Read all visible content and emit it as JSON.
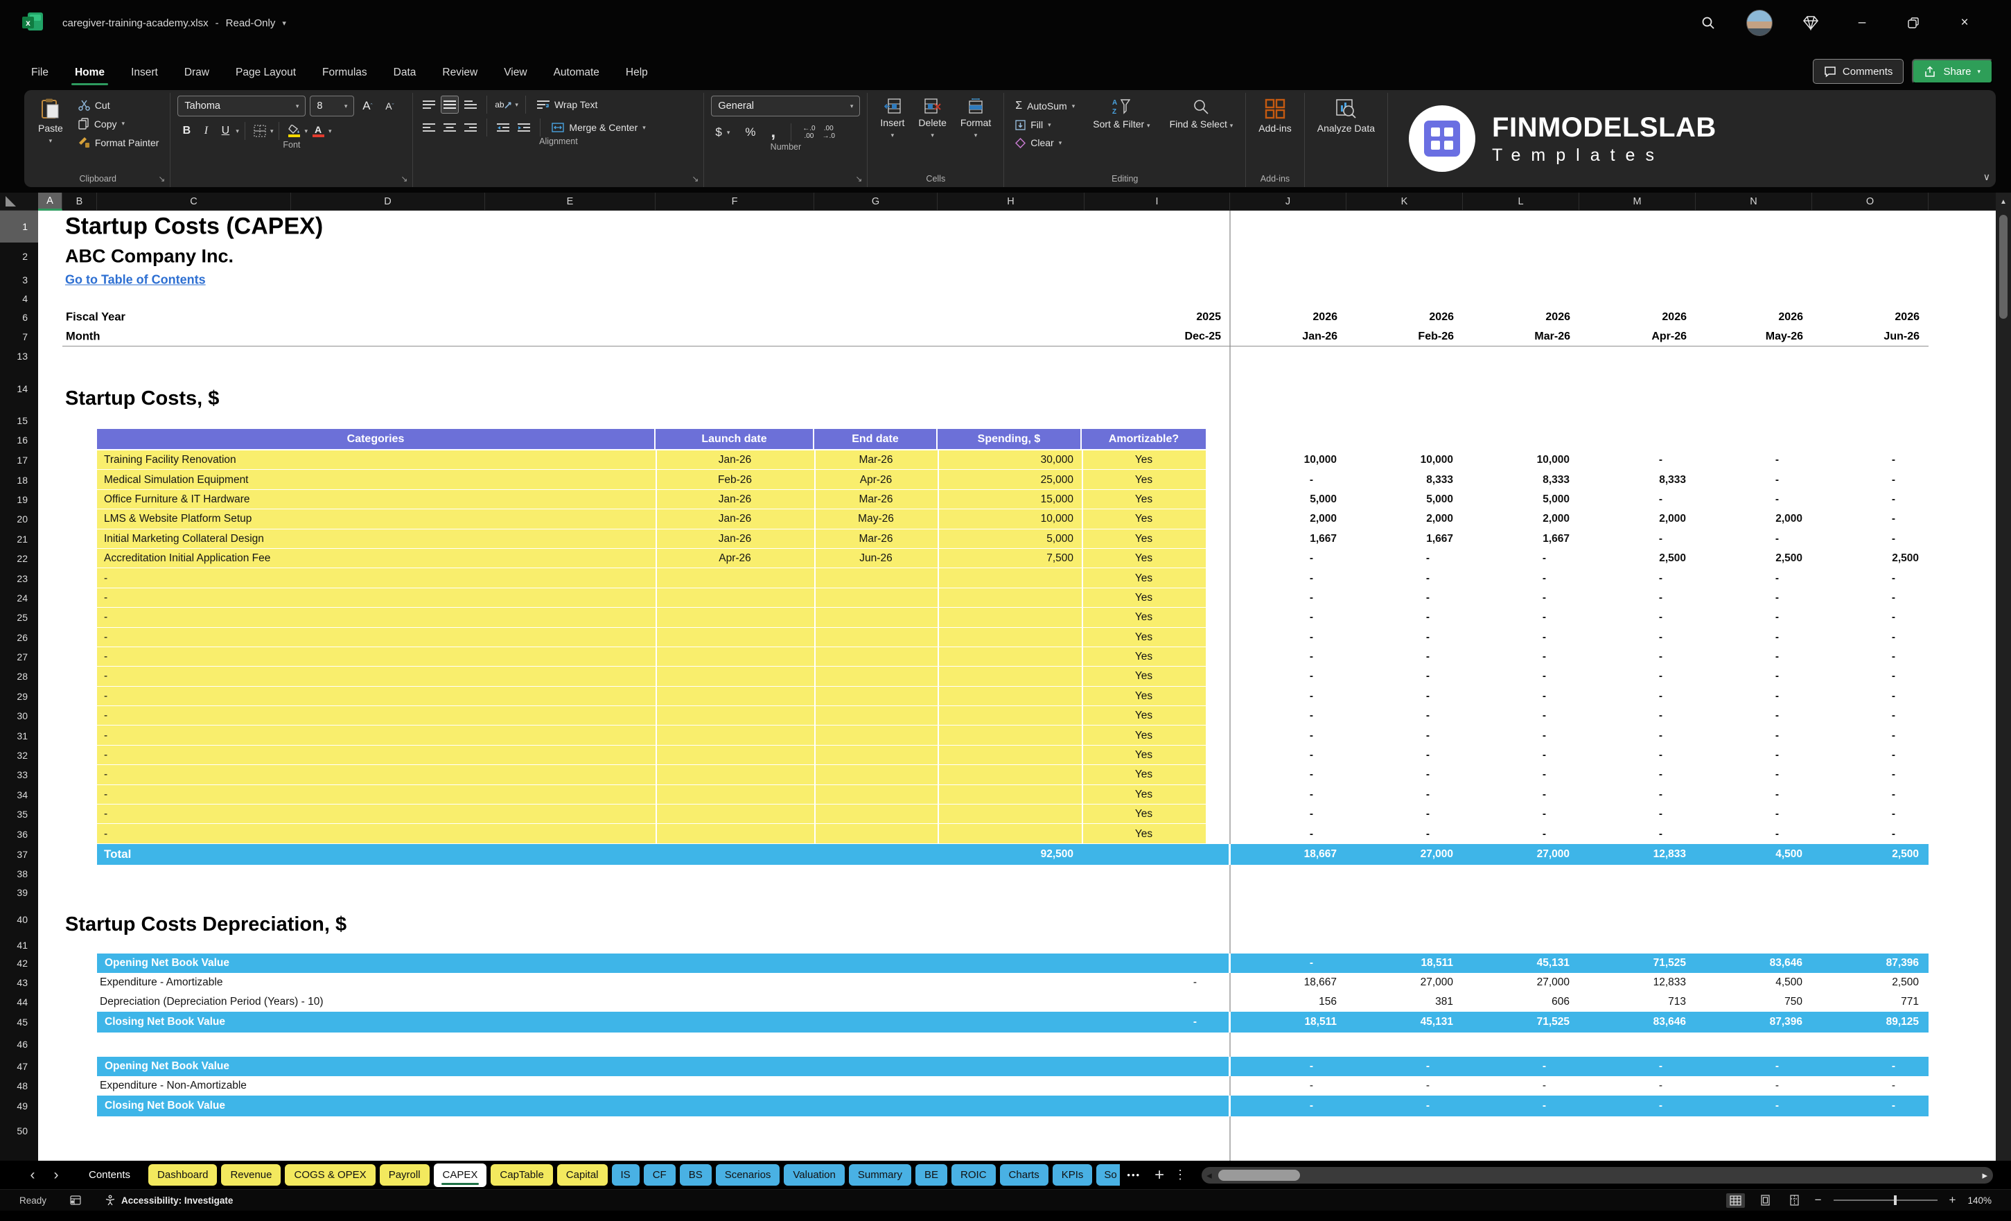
{
  "window": {
    "filename": "caregiver-training-academy.xlsx",
    "dash": "-",
    "mode": "Read-Only"
  },
  "menu": {
    "tabs": [
      "File",
      "Home",
      "Insert",
      "Draw",
      "Page Layout",
      "Formulas",
      "Data",
      "Review",
      "View",
      "Automate",
      "Help"
    ],
    "active_tab": "Home",
    "comments_label": "Comments",
    "share_label": "Share"
  },
  "ribbon": {
    "clipboard": {
      "label": "Clipboard",
      "paste": "Paste",
      "cut": "Cut",
      "copy": "Copy",
      "format_painter": "Format Painter"
    },
    "font": {
      "label": "Font",
      "family": "Tahoma",
      "size": "8",
      "bold": "B",
      "italic": "I",
      "underline": "U"
    },
    "alignment": {
      "label": "Alignment",
      "wrap_text": "Wrap Text",
      "merge_center": "Merge & Center"
    },
    "number": {
      "label": "Number",
      "format": "General",
      "currency": "$",
      "percent": "%",
      "comma": ",",
      "increase_decimal": "←.0\n.00",
      "decrease_decimal": ".00\n→.0"
    },
    "cells": {
      "label": "Cells",
      "insert": "Insert",
      "delete": "Delete",
      "format": "Format"
    },
    "editing": {
      "label": "Editing",
      "sigma": "Σ",
      "autosum": "AutoSum",
      "fill": "Fill",
      "clear": "Clear",
      "sort_filter": "Sort & Filter",
      "find_select": "Find & Select"
    },
    "addins": {
      "label": "Add-ins",
      "button": "Add-ins",
      "analyze": "Analyze Data"
    }
  },
  "brand": {
    "name": "FINMODELSLAB",
    "sub": "Templates"
  },
  "grid": {
    "columns": [
      "A",
      "B",
      "C",
      "D",
      "E",
      "F",
      "G",
      "H",
      "I",
      "J",
      "K",
      "L",
      "M",
      "N",
      "O"
    ],
    "selected_column": "A",
    "rows": [
      1,
      2,
      3,
      4,
      6,
      7,
      13,
      14,
      15,
      16,
      17,
      18,
      19,
      20,
      21,
      22,
      23,
      24,
      25,
      26,
      27,
      28,
      29,
      30,
      31,
      32,
      33,
      34,
      35,
      36,
      37,
      38,
      39,
      40,
      41,
      42,
      43,
      44,
      45,
      46,
      47,
      48,
      49,
      50
    ],
    "selected_row": 1
  },
  "sheet": {
    "title": "Startup Costs (CAPEX)",
    "company": "ABC Company Inc.",
    "toc_link": "Go to Table of Contents",
    "fiscal_year_label": "Fiscal Year",
    "month_label": "Month",
    "fiscal_years": [
      "2025",
      "2026",
      "2026",
      "2026",
      "2026",
      "2026",
      "2026"
    ],
    "months": [
      "Dec-25",
      "Jan-26",
      "Feb-26",
      "Mar-26",
      "Apr-26",
      "May-26",
      "Jun-26"
    ],
    "section_costs": {
      "heading": "Startup Costs, $",
      "columns": [
        "Categories",
        "Launch date",
        "End date",
        "Spending, $",
        "Amortizable?"
      ],
      "rows": [
        {
          "category": "Training Facility Renovation",
          "launch": "Jan-26",
          "end": "Mar-26",
          "spending": "30,000",
          "amortizable": "Yes",
          "monthly": [
            "10,000",
            "10,000",
            "10,000",
            "-",
            "-",
            "-"
          ]
        },
        {
          "category": "Medical Simulation Equipment",
          "launch": "Feb-26",
          "end": "Apr-26",
          "spending": "25,000",
          "amortizable": "Yes",
          "monthly": [
            "-",
            "8,333",
            "8,333",
            "8,333",
            "-",
            "-"
          ]
        },
        {
          "category": "Office Furniture & IT Hardware",
          "launch": "Jan-26",
          "end": "Mar-26",
          "spending": "15,000",
          "amortizable": "Yes",
          "monthly": [
            "5,000",
            "5,000",
            "5,000",
            "-",
            "-",
            "-"
          ]
        },
        {
          "category": "LMS & Website Platform Setup",
          "launch": "Jan-26",
          "end": "May-26",
          "spending": "10,000",
          "amortizable": "Yes",
          "monthly": [
            "2,000",
            "2,000",
            "2,000",
            "2,000",
            "2,000",
            "-"
          ]
        },
        {
          "category": "Initial Marketing Collateral Design",
          "launch": "Jan-26",
          "end": "Mar-26",
          "spending": "5,000",
          "amortizable": "Yes",
          "monthly": [
            "1,667",
            "1,667",
            "1,667",
            "-",
            "-",
            "-"
          ]
        },
        {
          "category": "Accreditation Initial Application Fee",
          "launch": "Apr-26",
          "end": "Jun-26",
          "spending": "7,500",
          "amortizable": "Yes",
          "monthly": [
            "-",
            "-",
            "-",
            "2,500",
            "2,500",
            "2,500"
          ]
        },
        {
          "category": "-",
          "launch": "",
          "end": "",
          "spending": "",
          "amortizable": "Yes",
          "monthly": [
            "-",
            "-",
            "-",
            "-",
            "-",
            "-"
          ]
        },
        {
          "category": "-",
          "launch": "",
          "end": "",
          "spending": "",
          "amortizable": "Yes",
          "monthly": [
            "-",
            "-",
            "-",
            "-",
            "-",
            "-"
          ]
        },
        {
          "category": "-",
          "launch": "",
          "end": "",
          "spending": "",
          "amortizable": "Yes",
          "monthly": [
            "-",
            "-",
            "-",
            "-",
            "-",
            "-"
          ]
        },
        {
          "category": "-",
          "launch": "",
          "end": "",
          "spending": "",
          "amortizable": "Yes",
          "monthly": [
            "-",
            "-",
            "-",
            "-",
            "-",
            "-"
          ]
        },
        {
          "category": "-",
          "launch": "",
          "end": "",
          "spending": "",
          "amortizable": "Yes",
          "monthly": [
            "-",
            "-",
            "-",
            "-",
            "-",
            "-"
          ]
        },
        {
          "category": "-",
          "launch": "",
          "end": "",
          "spending": "",
          "amortizable": "Yes",
          "monthly": [
            "-",
            "-",
            "-",
            "-",
            "-",
            "-"
          ]
        },
        {
          "category": "-",
          "launch": "",
          "end": "",
          "spending": "",
          "amortizable": "Yes",
          "monthly": [
            "-",
            "-",
            "-",
            "-",
            "-",
            "-"
          ]
        },
        {
          "category": "-",
          "launch": "",
          "end": "",
          "spending": "",
          "amortizable": "Yes",
          "monthly": [
            "-",
            "-",
            "-",
            "-",
            "-",
            "-"
          ]
        },
        {
          "category": "-",
          "launch": "",
          "end": "",
          "spending": "",
          "amortizable": "Yes",
          "monthly": [
            "-",
            "-",
            "-",
            "-",
            "-",
            "-"
          ]
        },
        {
          "category": "-",
          "launch": "",
          "end": "",
          "spending": "",
          "amortizable": "Yes",
          "monthly": [
            "-",
            "-",
            "-",
            "-",
            "-",
            "-"
          ]
        },
        {
          "category": "-",
          "launch": "",
          "end": "",
          "spending": "",
          "amortizable": "Yes",
          "monthly": [
            "-",
            "-",
            "-",
            "-",
            "-",
            "-"
          ]
        },
        {
          "category": "-",
          "launch": "",
          "end": "",
          "spending": "",
          "amortizable": "Yes",
          "monthly": [
            "-",
            "-",
            "-",
            "-",
            "-",
            "-"
          ]
        },
        {
          "category": "-",
          "launch": "",
          "end": "",
          "spending": "",
          "amortizable": "Yes",
          "monthly": [
            "-",
            "-",
            "-",
            "-",
            "-",
            "-"
          ]
        },
        {
          "category": "-",
          "launch": "",
          "end": "",
          "spending": "",
          "amortizable": "Yes",
          "monthly": [
            "-",
            "-",
            "-",
            "-",
            "-",
            "-"
          ]
        }
      ],
      "total": {
        "label": "Total",
        "spending": "92,500",
        "monthly": [
          "18,667",
          "27,000",
          "27,000",
          "12,833",
          "4,500",
          "2,500"
        ]
      }
    },
    "section_depreciation": {
      "heading": "Startup Costs Depreciation, $",
      "block1": [
        {
          "label": "Opening Net Book Value",
          "band": true,
          "prior": "",
          "monthly": [
            "-",
            "18,511",
            "45,131",
            "71,525",
            "83,646",
            "87,396"
          ]
        },
        {
          "label": "Expenditure - Amortizable",
          "band": false,
          "prior": "-",
          "monthly": [
            "18,667",
            "27,000",
            "27,000",
            "12,833",
            "4,500",
            "2,500"
          ]
        },
        {
          "label": "Depreciation (Depreciation Period (Years) - 10)",
          "band": false,
          "prior": "",
          "monthly": [
            "156",
            "381",
            "606",
            "713",
            "750",
            "771"
          ]
        },
        {
          "label": "Closing Net Book Value",
          "band": true,
          "prior": "-",
          "monthly": [
            "18,511",
            "45,131",
            "71,525",
            "83,646",
            "87,396",
            "89,125"
          ]
        }
      ],
      "block2": [
        {
          "label": "Opening Net Book Value",
          "band": true,
          "prior": "",
          "monthly": [
            "-",
            "-",
            "-",
            "-",
            "-",
            "-"
          ]
        },
        {
          "label": "Expenditure - Non-Amortizable",
          "band": false,
          "prior": "",
          "monthly": [
            "-",
            "-",
            "-",
            "-",
            "-",
            "-"
          ]
        },
        {
          "label": "Closing Net Book Value",
          "band": true,
          "prior": "",
          "monthly": [
            "-",
            "-",
            "-",
            "-",
            "-",
            "-"
          ]
        }
      ]
    }
  },
  "sheet_tabs": {
    "items": [
      {
        "label": "Contents",
        "color": "plain"
      },
      {
        "label": "Dashboard",
        "color": "yellow"
      },
      {
        "label": "Revenue",
        "color": "yellow"
      },
      {
        "label": "COGS & OPEX",
        "color": "yellow"
      },
      {
        "label": "Payroll",
        "color": "yellow"
      },
      {
        "label": "CAPEX",
        "color": "active"
      },
      {
        "label": "CapTable",
        "color": "yellow"
      },
      {
        "label": "Capital",
        "color": "yellow"
      },
      {
        "label": "IS",
        "color": "blue"
      },
      {
        "label": "CF",
        "color": "blue"
      },
      {
        "label": "BS",
        "color": "blue"
      },
      {
        "label": "Scenarios",
        "color": "blue"
      },
      {
        "label": "Valuation",
        "color": "blue"
      },
      {
        "label": "Summary",
        "color": "blue"
      },
      {
        "label": "BE",
        "color": "blue"
      },
      {
        "label": "ROIC",
        "color": "blue"
      },
      {
        "label": "Charts",
        "color": "blue"
      },
      {
        "label": "KPIs",
        "color": "blue"
      },
      {
        "label": "So",
        "color": "blue",
        "truncated": true
      }
    ],
    "active": "CAPEX"
  },
  "status": {
    "ready": "Ready",
    "accessibility": "Accessibility: Investigate",
    "zoom": "140%"
  },
  "colors": {
    "header_purple": "#6c70d8",
    "row_yellow": "#f9ee6d",
    "band_cyan": "#3eb5e8",
    "tab_yellow": "#f3e95e",
    "tab_blue": "#49b1e4",
    "accent_green": "#2e9b5f",
    "link_blue": "#2d6fd2",
    "addins_orange": "#c55a11",
    "fill_yellow": "#f5d800",
    "fontcolor_red": "#e23b2e"
  }
}
